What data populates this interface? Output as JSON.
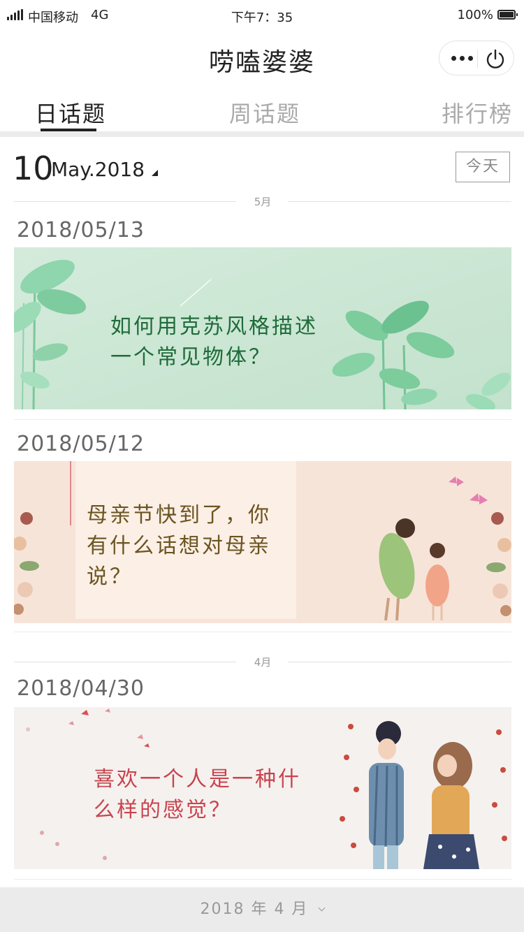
{
  "status_bar": {
    "carrier": "中国移动",
    "network": "4G",
    "time": "下午7：35",
    "battery": "100%",
    "battery_level": 1.0
  },
  "nav": {
    "title": "唠嗑婆婆",
    "more_icon": "more-dots-icon",
    "close_icon": "power-icon"
  },
  "tabs": [
    {
      "label": "日话题",
      "active": true
    },
    {
      "label": "周话题",
      "active": false
    },
    {
      "label": "排行榜",
      "active": false
    }
  ],
  "date_header": {
    "day": "10",
    "month_year": "May.2018",
    "today_button": "今天"
  },
  "month_dividers": [
    "5月",
    "4月"
  ],
  "topics": [
    {
      "date": "2018/05/13",
      "title_lines": [
        "如何用克苏风格描述",
        "一个常见物体？"
      ],
      "text_color": "#1f6b3a"
    },
    {
      "date": "2018/05/12",
      "title_lines": [
        "母亲节快到了，你",
        "有什么话想对母亲",
        "说？"
      ],
      "text_color": "#6b5420"
    },
    {
      "date": "2018/04/30",
      "title_lines": [
        "喜欢一个人是一种什",
        "么样的感觉？"
      ],
      "text_color": "#c8444e"
    }
  ],
  "footer": {
    "year_month": "2018 年 4 月"
  }
}
